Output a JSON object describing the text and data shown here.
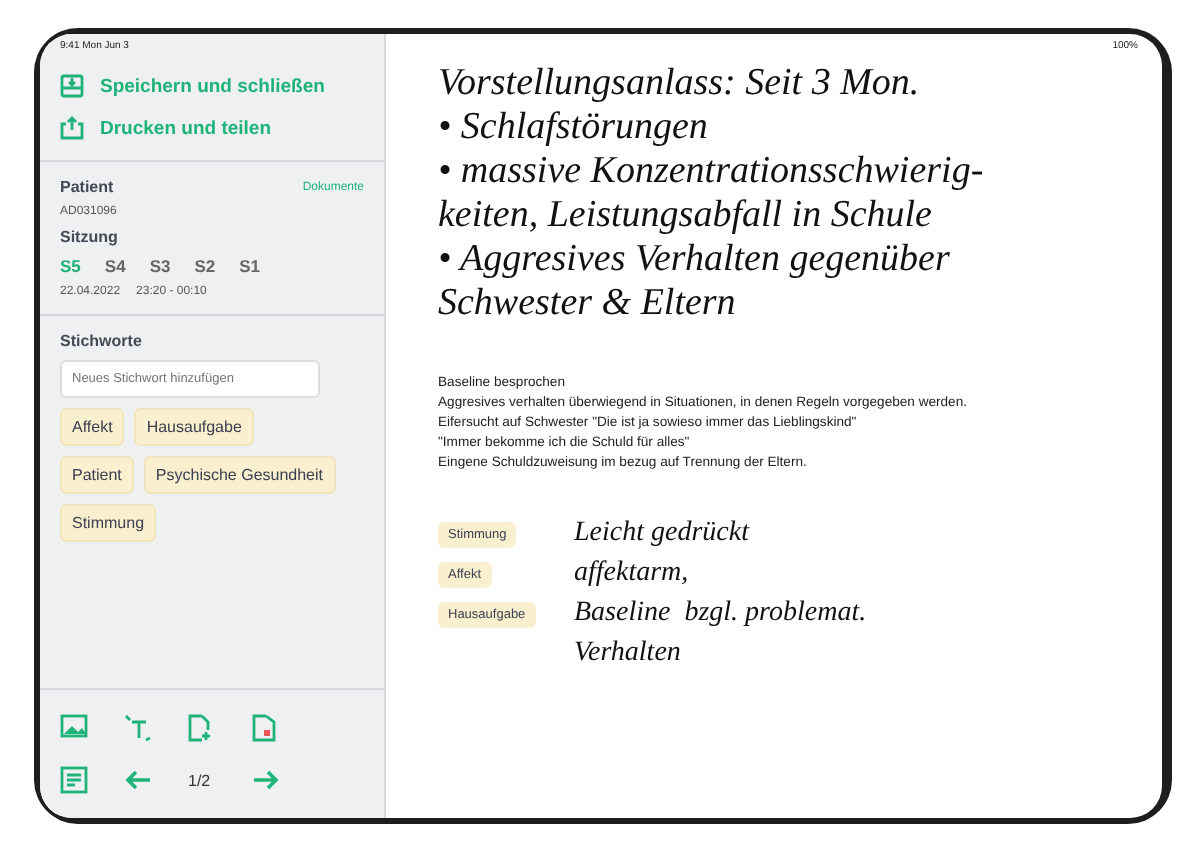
{
  "status_bar": {
    "time": "9:41 Mon Jun 3",
    "battery": "100%"
  },
  "sidebar": {
    "actions": [
      {
        "kind": "save",
        "label": "Speichern und schließen"
      },
      {
        "kind": "share",
        "label": "Drucken und teilen"
      }
    ],
    "patient": {
      "heading": "Patient",
      "link": "Dokumente",
      "id": "AD031096"
    },
    "session": {
      "heading": "Sitzung",
      "sessions": [
        {
          "label": "S5",
          "selected": true
        },
        {
          "label": "S4",
          "selected": false
        },
        {
          "label": "S3",
          "selected": false
        },
        {
          "label": "S2",
          "selected": false
        },
        {
          "label": "S1",
          "selected": false
        }
      ],
      "date": "22.04.2022",
      "time": "23:20 - 00:10"
    },
    "keywords": {
      "heading": "Stichworte",
      "placeholder": "Neues Stichwort hinzufügen",
      "tags": [
        [
          "Affekt",
          "Hausaufgabe"
        ],
        [
          "Patient",
          "Psychische Gesundheit"
        ],
        [
          "Stimmung"
        ]
      ]
    },
    "toolbar": {
      "tools": [
        {
          "kind": "image"
        },
        {
          "kind": "text"
        },
        {
          "kind": "add-page"
        },
        {
          "kind": "delete-page"
        }
      ],
      "page_indicator": "1/2"
    }
  },
  "note": {
    "handwriting": [
      "Vorstellungsanlass: Seit 3 Mon.",
      "• Schlafstörungen",
      "• massive Konzentrationsschwierig-",
      "keiten, Leistungsabfall in Schule",
      "• Aggresives Verhalten gegenüber",
      "Schwester & Eltern"
    ],
    "typed": [
      "Baseline besprochen",
      "Aggresives verhalten überwiegend in Situationen, in denen Regeln vorgegeben werden.",
      "Eifersucht auf Schwester \"Die ist ja sowieso immer das Lieblingskind\"",
      "\"Immer bekomme ich die Schuld für alles\"",
      "Eingene Schuldzuweisung im bezug auf Trennung der Eltern."
    ],
    "tagged": [
      {
        "tag": "Stimmung",
        "text": "Leicht gedrückt"
      },
      {
        "tag": "Affekt",
        "text": "affektarm,"
      },
      {
        "tag": "Hausaufgabe",
        "text": "Baseline  bzgl. problemat."
      },
      {
        "text": "Verhalten"
      }
    ]
  }
}
